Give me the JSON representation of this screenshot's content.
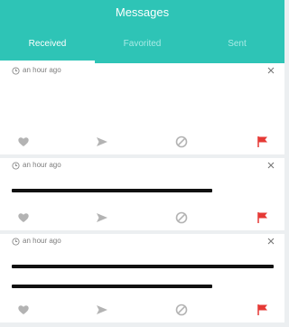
{
  "header": {
    "title": "Messages",
    "tabs": [
      {
        "label": "Received",
        "active": true
      },
      {
        "label": "Favorited",
        "active": false
      },
      {
        "label": "Sent",
        "active": false
      }
    ]
  },
  "colors": {
    "accent": "#2ec4b6",
    "inactive_tab": "#a9ebe6",
    "icon_gray": "#b3b3b3",
    "flag_red": "#e53935"
  },
  "messages": [
    {
      "time": "an hour ago",
      "body": "",
      "redacted": false
    },
    {
      "time": "an hour ago",
      "redacted": true,
      "redacted_lines": 1
    },
    {
      "time": "an hour ago",
      "redacted": true,
      "redacted_lines": 2
    }
  ],
  "icons": {
    "timestamp": "clock-icon",
    "dismiss": "close-icon",
    "favorite": "heart-icon",
    "reply": "send-icon",
    "block": "block-icon",
    "report": "flag-icon"
  }
}
